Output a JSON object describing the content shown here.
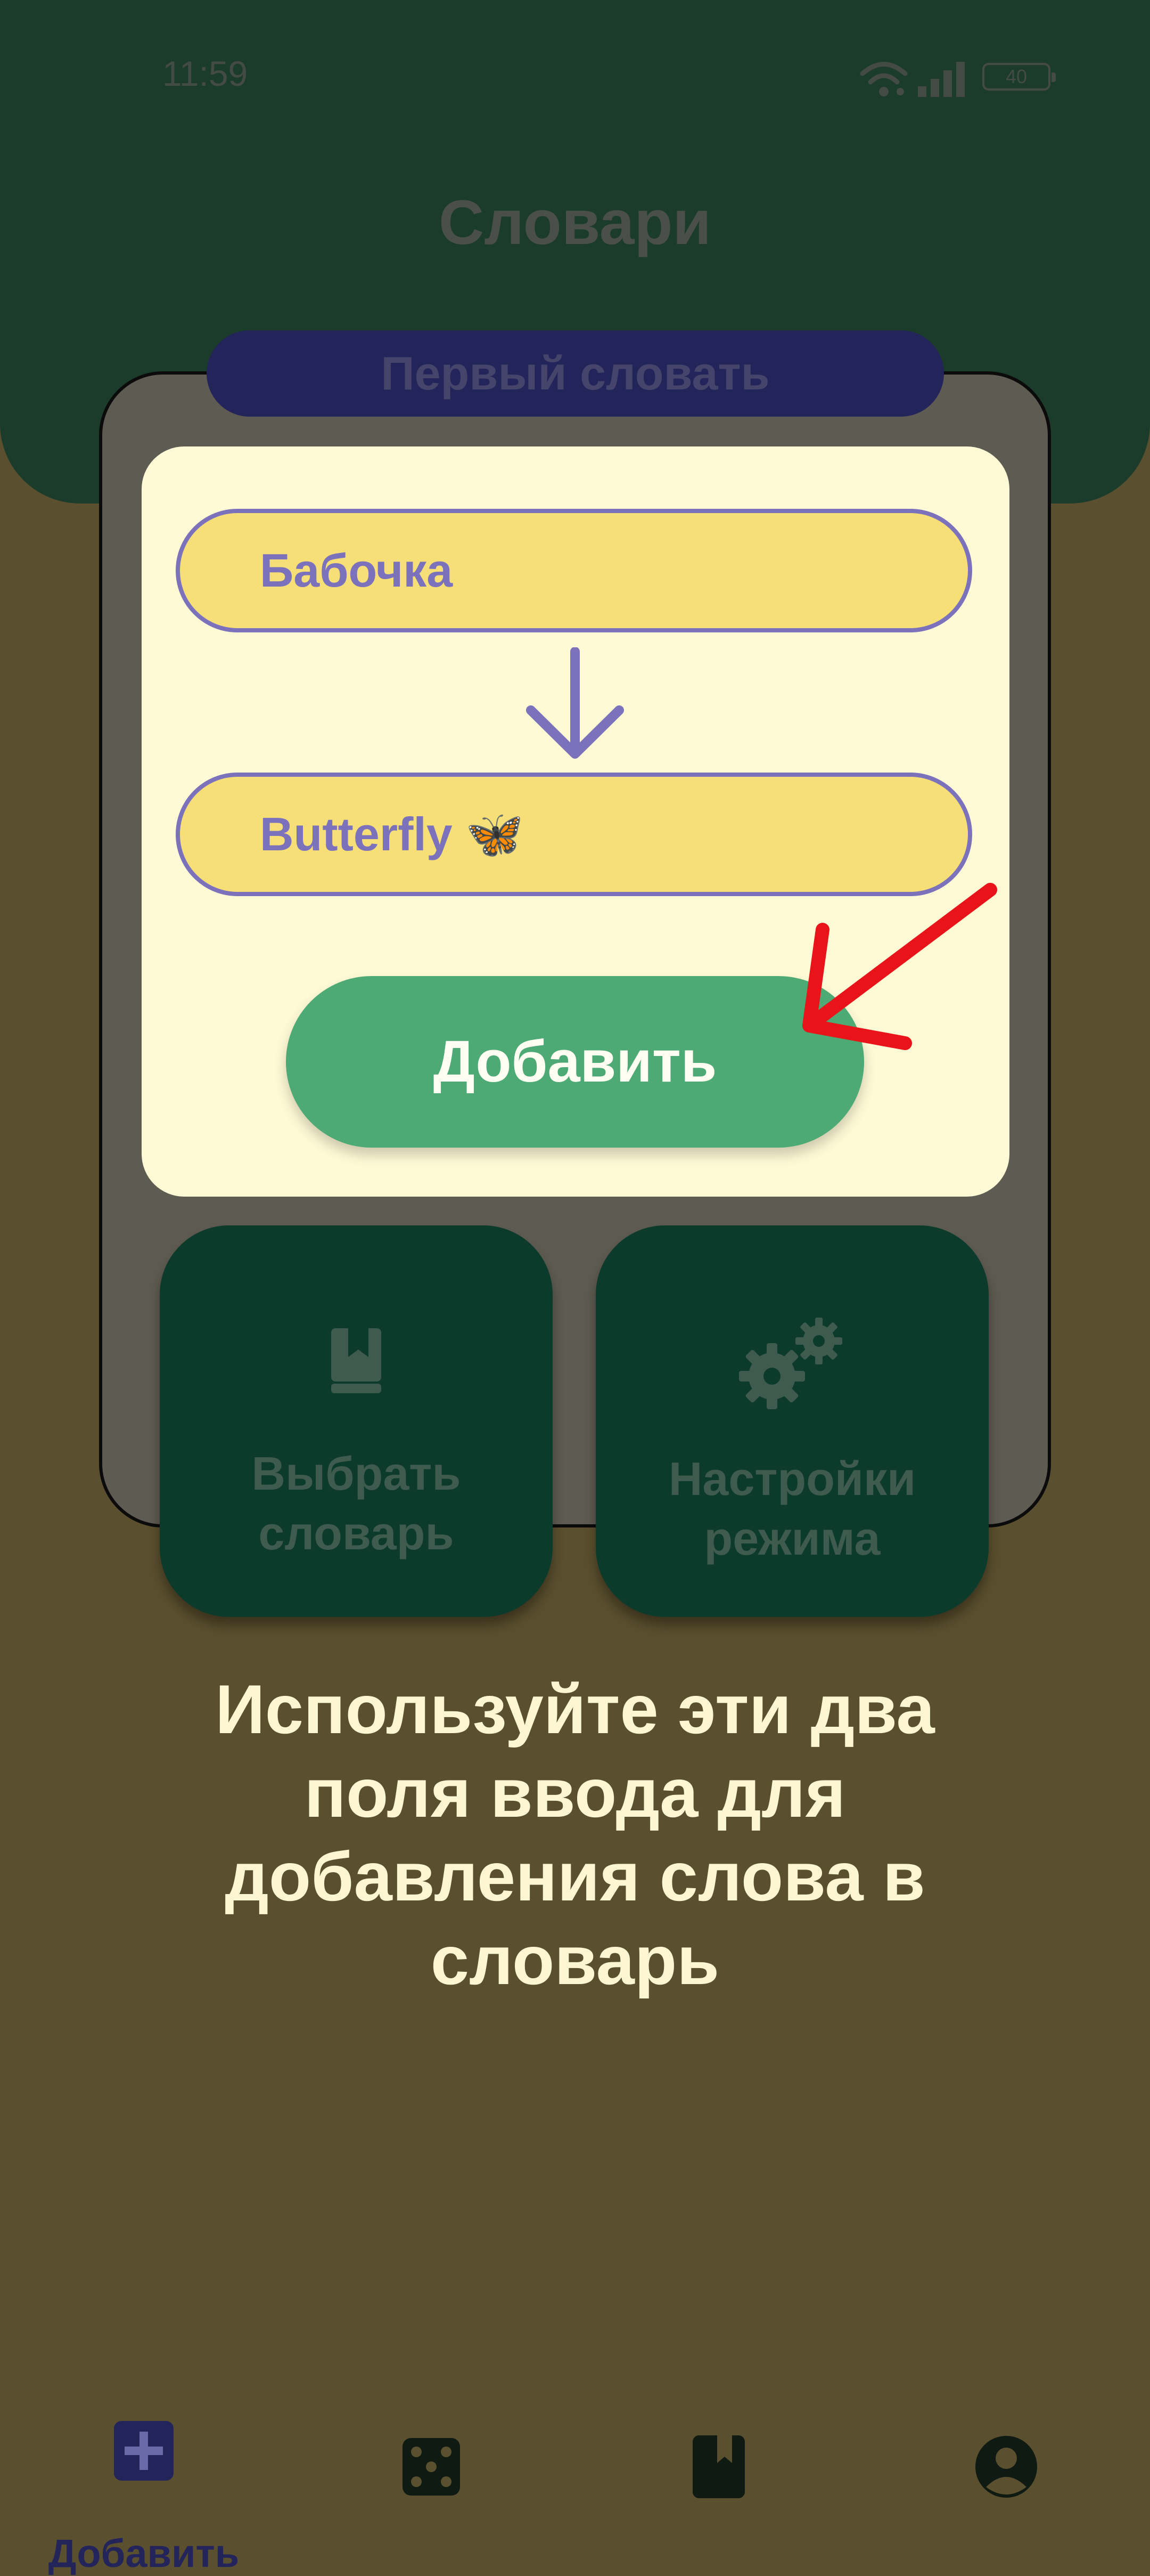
{
  "status_bar": {
    "time": "11:59",
    "battery": "40"
  },
  "page": {
    "title": "Словари"
  },
  "dictionary": {
    "name": "Первый словать"
  },
  "form": {
    "source_value": "Бабочка",
    "target_value": "Butterfly 🦋",
    "add_button_label": "Добавить"
  },
  "tiles": {
    "choose_dictionary_line1": "Выбрать",
    "choose_dictionary_line2": "словарь",
    "mode_settings_line1": "Настройки",
    "mode_settings_line2": "режима"
  },
  "tutorial": {
    "hint": "Используйте эти два поля ввода для добавления слова в словарь"
  },
  "bottom_nav": {
    "items": [
      {
        "label": "Добавить",
        "icon": "add-square-icon",
        "active": true
      },
      {
        "label": "",
        "icon": "dice-icon",
        "active": false
      },
      {
        "label": "",
        "icon": "bookmark-book-icon",
        "active": false
      },
      {
        "label": "",
        "icon": "account-icon",
        "active": false
      }
    ]
  },
  "colors": {
    "header": "#1c3c2b",
    "background": "#5a4f2e",
    "panel": "#fffad6",
    "field": "#f7df78",
    "field_border": "#7b72bb",
    "add_button": "#4eaa74",
    "tile": "#0d3b2b",
    "dictionary_pill": "#22245a",
    "pointer": "#e8141a"
  }
}
